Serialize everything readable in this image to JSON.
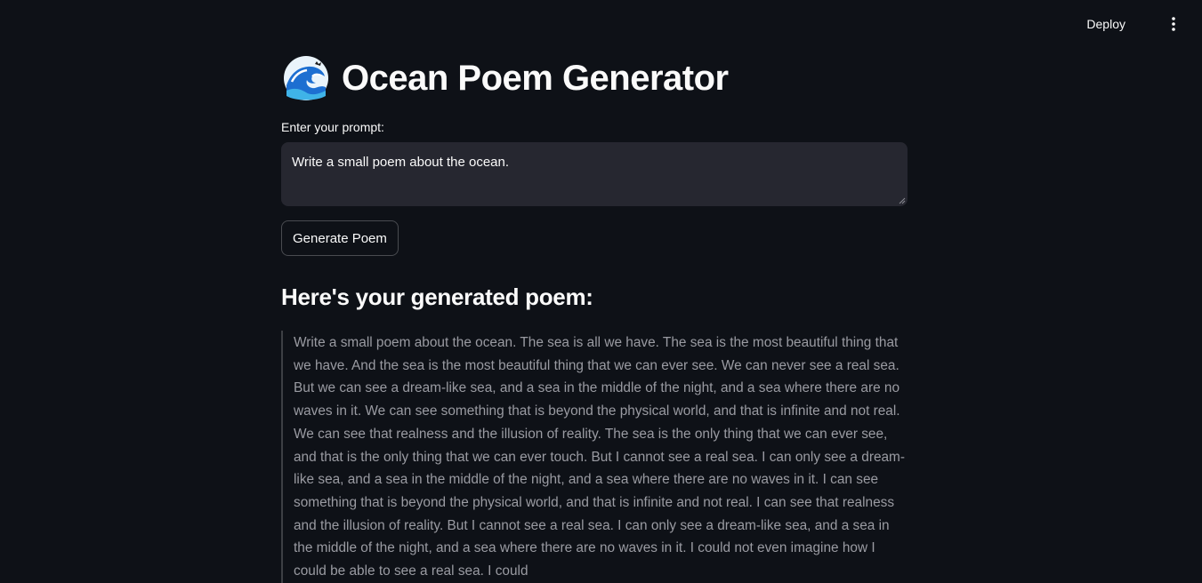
{
  "header": {
    "deploy_label": "Deploy",
    "menu_icon": "more-vertical-icon"
  },
  "app": {
    "title_icon": "water-wave-emoji",
    "title": "Ocean Poem Generator",
    "prompt_label": "Enter your prompt:",
    "prompt_value": "Write a small poem about the ocean.",
    "generate_label": "Generate Poem",
    "result_heading": "Here's your generated poem:",
    "poem_text": "Write a small poem about the ocean. The sea is all we have. The sea is the most beautiful thing that we have. And the sea is the most beautiful thing that we can ever see. We can never see a real sea. But we can see a dream-like sea, and a sea in the middle of the night, and a sea where there are no waves in it. We can see something that is beyond the physical world, and that is infinite and not real. We can see that realness and the illusion of reality. The sea is the only thing that we can ever see, and that is the only thing that we can ever touch. But I cannot see a real sea. I can only see a dream-like sea, and a sea in the middle of the night, and a sea where there are no waves in it. I can see something that is beyond the physical world, and that is infinite and not real. I can see that realness and the illusion of reality. But I cannot see a real sea. I can only see a dream-like sea, and a sea in the middle of the night, and a sea where there are no waves in it. I could not even imagine how I could be able to see a real sea. I could"
  },
  "colors": {
    "background": "#0e1117",
    "input_background": "#262730",
    "text": "#fafafa",
    "muted_text": "#9a9ba2"
  }
}
